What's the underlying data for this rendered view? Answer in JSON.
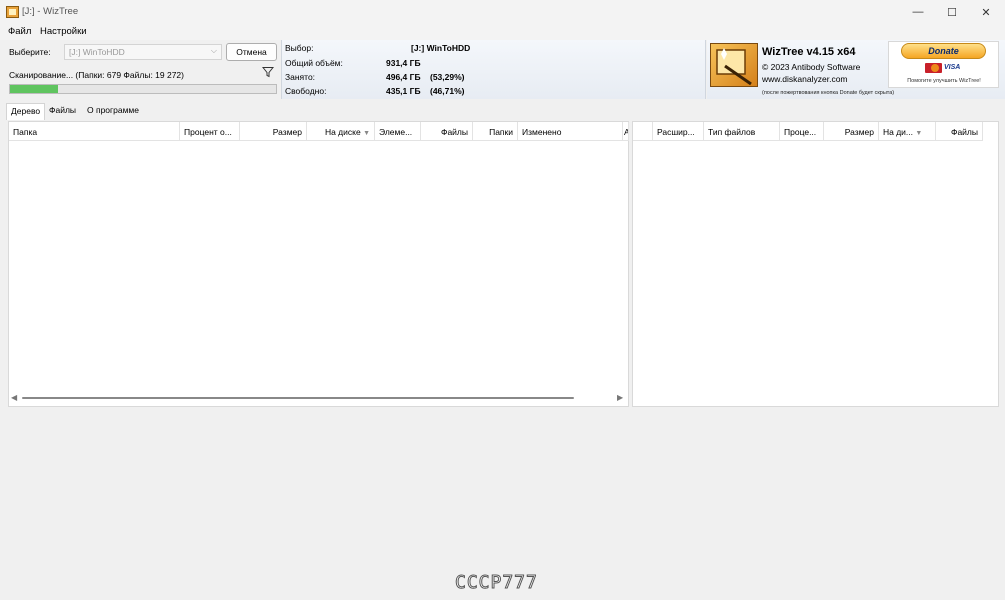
{
  "window": {
    "title": "[J:]  - WizTree",
    "minimize": "—",
    "maximize": "☐",
    "close": "✕"
  },
  "menu": [
    "Файл",
    "Настройки"
  ],
  "scan": {
    "select_label": "Выберите:",
    "drive_value": "[J:] WinToHDD",
    "cancel_label": "Отмена",
    "status": "Сканирование... (Папки: 679  Файлы: 19 272)",
    "progress_fraction": 0.18,
    "progress_color": "#5fc45f"
  },
  "drive_info": {
    "selection_label": "Выбор:",
    "selection_value": "[J:]  WinToHDD",
    "total_label": "Общий объём:",
    "total_value": "931,4 ГБ",
    "used_label": "Занято:",
    "used_value": "496,4 ГБ",
    "used_pct": "(53,29%)",
    "free_label": "Свободно:",
    "free_value": "435,1 ГБ",
    "free_pct": "(46,71%)"
  },
  "brand": {
    "title": "WizTree v4.15 x64",
    "copyright": "© 2023 Antibody Software",
    "site": "www.diskanalyzer.com",
    "donate_label": "Donate",
    "visa": "VISA",
    "donate_help": "Помогите улучшить WizTree!",
    "donate_note": "(после пожертвования кнопка Donate будет скрыта)"
  },
  "tabs": [
    "Дерево",
    "Файлы",
    "О программе"
  ],
  "tree_columns": [
    "Папка",
    "Процент о...",
    "Размер",
    "На диске",
    "Элеме...",
    "Файлы",
    "Папки",
    "Изменено",
    "А"
  ],
  "ext_columns": [
    "",
    "Расшир...",
    "Тип файлов",
    "Проце...",
    "Размер",
    "На ди...",
    "Файлы"
  ],
  "icons": {
    "filter": "filter-icon",
    "sort_desc": "▼",
    "scroll_left": "◀",
    "scroll_right": "▶",
    "combo_chevron": "⌵"
  },
  "watermark": "CCCP777"
}
